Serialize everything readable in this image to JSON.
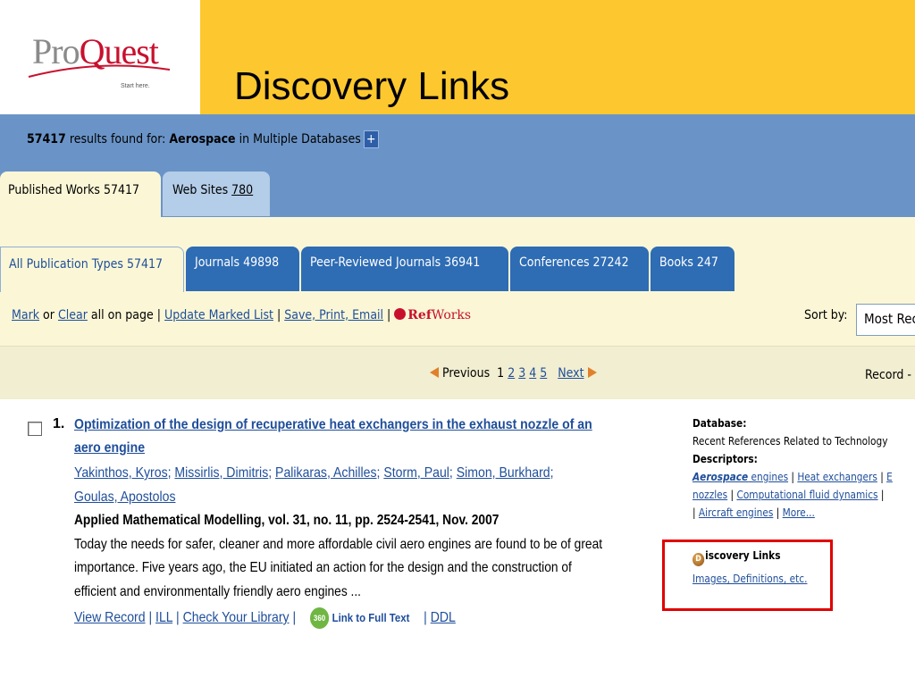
{
  "slide": {
    "logo_text_pro": "Pro",
    "logo_text_quest": "Quest",
    "logo_tagline": "Start here.",
    "title": "Discovery Links",
    "brand_color": "#fdc82f"
  },
  "results": {
    "count": "57417",
    "found_text": " results found for: ",
    "query": "Aerospace",
    "scope": " in Multiple Databases",
    "plus_label": "+"
  },
  "source_tabs": [
    {
      "label": "Published Works 57417",
      "count": ""
    },
    {
      "label": "Web Sites ",
      "count": "780"
    }
  ],
  "pub_tabs": [
    {
      "label": "All Publication Types 57417",
      "count": ""
    },
    {
      "label": "Journals ",
      "count": "49898"
    },
    {
      "label": "Peer-Reviewed Journals ",
      "count": "36941"
    },
    {
      "label": "Conferences ",
      "count": "27242"
    },
    {
      "label": "Books ",
      "count": "247"
    }
  ],
  "actions": {
    "mark": "Mark",
    "or": " or ",
    "clear": "Clear",
    "all_on_page": " all on page | ",
    "update": "Update Marked List",
    "sep1": " | ",
    "save": "Save, Print, Email",
    "sep2": " | ",
    "refworks_ref": "Ref",
    "refworks_works": "Works"
  },
  "sort": {
    "label": "Sort by:",
    "value": "Most Recent"
  },
  "pager": {
    "previous": "Previous",
    "current": "1",
    "pages": [
      "2",
      "3",
      "4",
      "5"
    ],
    "next": "Next",
    "record_label": "Record -"
  },
  "record": {
    "number": "1.",
    "title_line1": "Optimization of the design of recuperative heat exchangers in the exhaust nozzle of an",
    "title_line2": "aero engine",
    "authors": [
      "Yakinthos, Kyros",
      "Missirlis, Dimitris",
      "Palikaras, Achilles",
      "Storm, Paul",
      "Simon, Burkhard",
      "Goulas, Apostolos"
    ],
    "source": "Applied Mathematical Modelling, vol. 31, no. 11, pp. 2524-2541, Nov. 2007",
    "abstract_lines": [
      "Today the needs for safer, cleaner and more affordable civil aero engines are found to be of great",
      "importance. Five years ago, the EU initiated an action for the design and the construction of",
      "efficient and environmentally friendly aero engines ..."
    ],
    "links": {
      "view_record": "View Record",
      "ill": "ILL",
      "check_library": "Check Your Library",
      "badge": "360",
      "full_text": "Link to Full Text",
      "ddl": "DDL",
      "sep": " | "
    }
  },
  "sidebar": {
    "database_label": "Database:",
    "database_value": "Recent References Related to Technology",
    "descriptors_label": "Descriptors:",
    "descriptor_hl": "Aerospace",
    "descriptor1_rest": " engines",
    "descriptor2": "Heat exchangers",
    "descriptor3": "E",
    "descriptor4": "nozzles",
    "descriptor5": "Computational fluid dynamics",
    "descriptor6": "Aircraft engines",
    "more": "More...",
    "discovery_icon": "D",
    "discovery_title": "iscovery Links",
    "discovery_link": "Images, Definitions, etc."
  },
  "colors": {
    "header_blue": "#6a94c8",
    "tab_blue": "#2e6cb4",
    "light_yellow": "#fbf7d6",
    "link_blue": "#1f4e9a",
    "highlight_red": "#e00000"
  }
}
